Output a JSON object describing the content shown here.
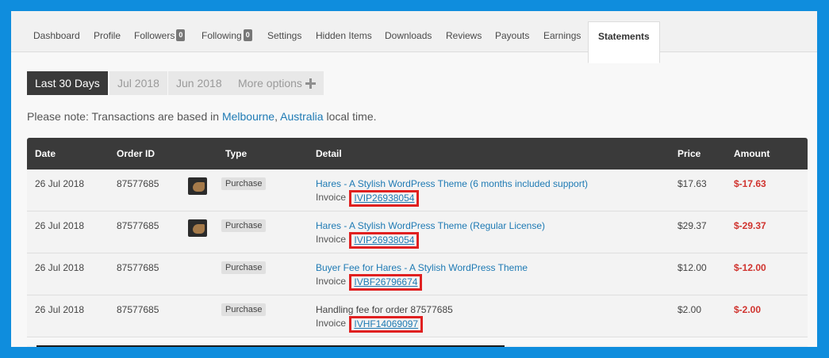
{
  "tabs": [
    {
      "label": "Dashboard"
    },
    {
      "label": "Profile"
    },
    {
      "label": "Followers",
      "badge": "0"
    },
    {
      "label": "Following",
      "badge": "0"
    },
    {
      "label": "Settings"
    },
    {
      "label": "Hidden Items"
    },
    {
      "label": "Downloads"
    },
    {
      "label": "Reviews"
    },
    {
      "label": "Payouts"
    },
    {
      "label": "Earnings"
    },
    {
      "label": "Statements",
      "active": true
    }
  ],
  "period_buttons": [
    "Last 30 Days",
    "Jul 2018",
    "Jun 2018",
    "More options"
  ],
  "note": {
    "prefix": "Please note: Transactions are based in ",
    "city": "Melbourne",
    "separator": ", ",
    "country": "Australia",
    "suffix": " local time."
  },
  "table": {
    "headers": [
      "Date",
      "Order ID",
      "Type",
      "Detail",
      "Price",
      "Amount"
    ],
    "invoice_label": "Invoice",
    "rows": [
      {
        "date": "26 Jul 2018",
        "order_id": "87577685",
        "has_thumb": true,
        "type": "Purchase",
        "detail": "Hares - A Stylish WordPress Theme (6 months included support)",
        "detail_link": true,
        "invoice": "IVIP26938054",
        "price": "$17.63",
        "amount": "$-17.63"
      },
      {
        "date": "26 Jul 2018",
        "order_id": "87577685",
        "has_thumb": true,
        "type": "Purchase",
        "detail": "Hares - A Stylish WordPress Theme (Regular License)",
        "detail_link": true,
        "invoice": "IVIP26938054",
        "price": "$29.37",
        "amount": "$-29.37"
      },
      {
        "date": "26 Jul 2018",
        "order_id": "87577685",
        "has_thumb": false,
        "type": "Purchase",
        "detail": "Buyer Fee for Hares - A Stylish WordPress Theme",
        "detail_link": true,
        "invoice": "IVBF26796674",
        "price": "$12.00",
        "amount": "$-12.00"
      },
      {
        "date": "26 Jul 2018",
        "order_id": "87577685",
        "has_thumb": false,
        "type": "Purchase",
        "detail": "Handling fee for order 87577685",
        "detail_link": false,
        "invoice": "IVHF14069097",
        "price": "$2.00",
        "amount": "$-2.00"
      }
    ]
  },
  "colors": {
    "frame_blue": "#0f8ddd",
    "header_dark": "#3a3a3a",
    "link_blue": "#1e7ab4",
    "negative_red": "#d0332e",
    "highlight_red": "#e02020"
  },
  "icons": {
    "more_options": "plus-icon",
    "thumbnail": "item-thumbnail-icon"
  }
}
